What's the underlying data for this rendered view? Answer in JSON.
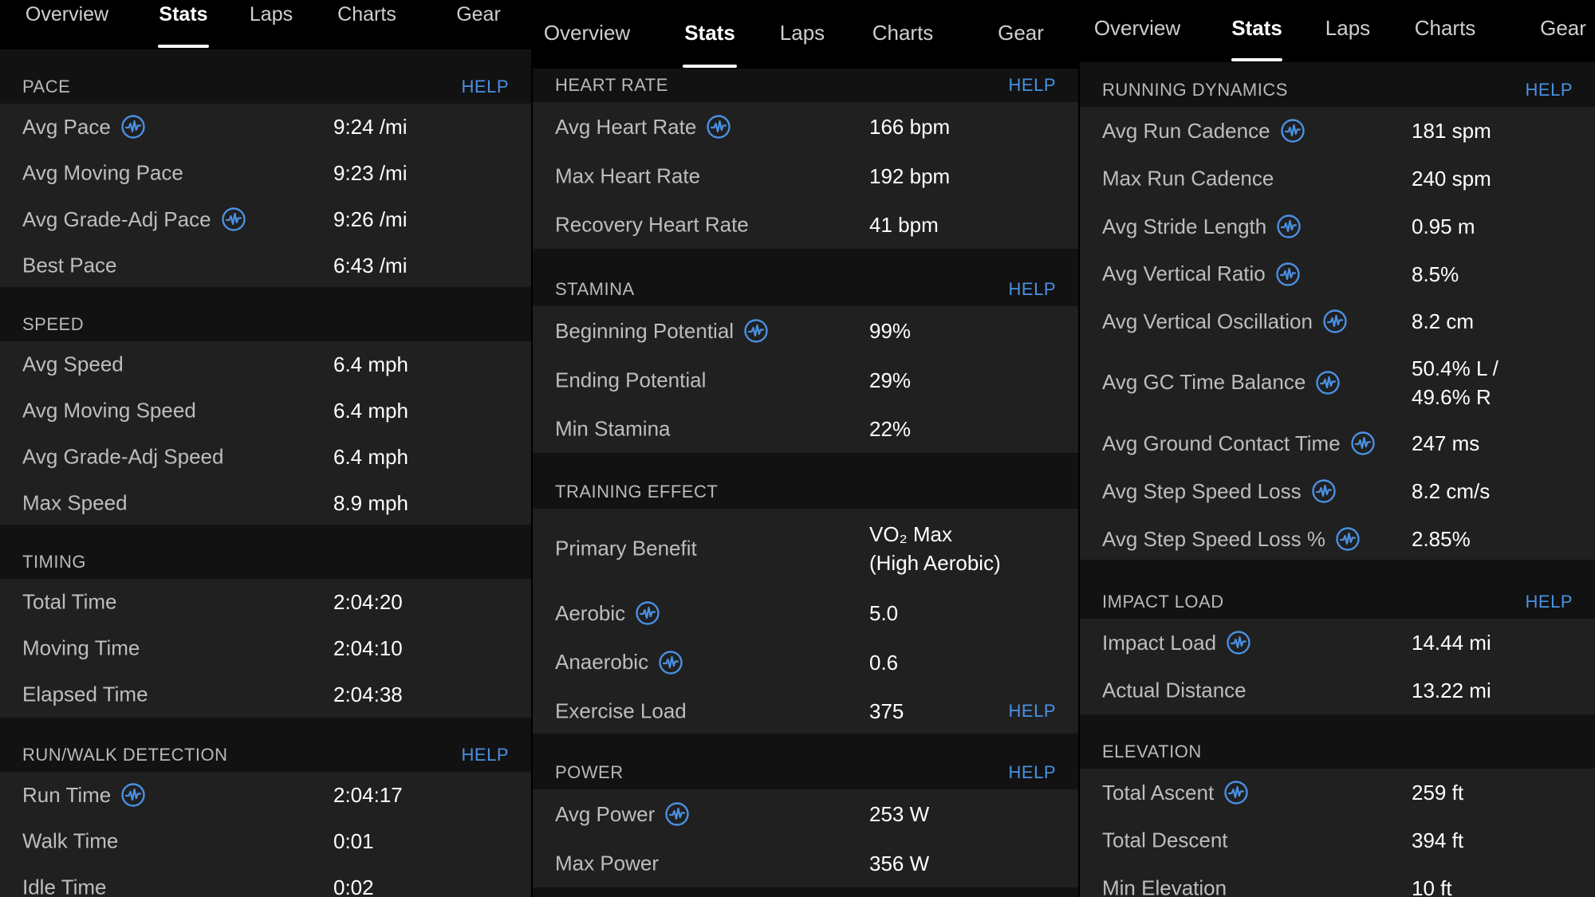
{
  "colors": {
    "accent": "#4a90e2",
    "background": "#121212",
    "row_background": "#202020",
    "header_background": "#000000"
  },
  "panels": [
    {
      "tabs": [
        {
          "label": "Overview",
          "name": "tab-overview",
          "active": false
        },
        {
          "label": "Stats",
          "name": "tab-stats",
          "active": true
        },
        {
          "label": "Laps",
          "name": "tab-laps",
          "active": false
        },
        {
          "label": "Charts",
          "name": "tab-charts",
          "active": false
        },
        {
          "label": "Gear",
          "name": "tab-gear",
          "active": false
        }
      ],
      "sections": [
        {
          "title": "PACE",
          "help": "HELP",
          "rows": [
            {
              "label": "Avg Pace",
              "chart_icon": "waveform-icon",
              "value": "9:24 /mi"
            },
            {
              "label": "Avg Moving Pace",
              "value": "9:23 /mi"
            },
            {
              "label": "Avg Grade-Adj Pace",
              "chart_icon": "waveform-icon",
              "value": "9:26 /mi"
            },
            {
              "label": "Best Pace",
              "value": "6:43 /mi"
            }
          ]
        },
        {
          "title": "SPEED",
          "rows": [
            {
              "label": "Avg Speed",
              "value": "6.4 mph"
            },
            {
              "label": "Avg Moving Speed",
              "value": "6.4 mph"
            },
            {
              "label": "Avg Grade-Adj Speed",
              "value": "6.4 mph"
            },
            {
              "label": "Max Speed",
              "value": "8.9 mph"
            }
          ]
        },
        {
          "title": "TIMING",
          "rows": [
            {
              "label": "Total Time",
              "value": "2:04:20"
            },
            {
              "label": "Moving Time",
              "value": "2:04:10"
            },
            {
              "label": "Elapsed Time",
              "value": "2:04:38"
            }
          ]
        },
        {
          "title": "RUN/WALK DETECTION",
          "help": "HELP",
          "rows": [
            {
              "label": "Run Time",
              "chart_icon": "waveform-icon",
              "value": "2:04:17"
            },
            {
              "label": "Walk Time",
              "value": "0:01"
            },
            {
              "label": "Idle Time",
              "value": "0:02"
            }
          ]
        }
      ]
    },
    {
      "tabs": [
        {
          "label": "Overview",
          "name": "tab-overview",
          "active": false
        },
        {
          "label": "Stats",
          "name": "tab-stats",
          "active": true
        },
        {
          "label": "Laps",
          "name": "tab-laps",
          "active": false
        },
        {
          "label": "Charts",
          "name": "tab-charts",
          "active": false
        },
        {
          "label": "Gear",
          "name": "tab-gear",
          "active": false
        }
      ],
      "sections": [
        {
          "title": "HEART RATE",
          "help": "HELP",
          "rows": [
            {
              "label": "Avg Heart Rate",
              "chart_icon": "waveform-icon",
              "value": "166 bpm"
            },
            {
              "label": "Max Heart Rate",
              "value": "192 bpm"
            },
            {
              "label": "Recovery Heart Rate",
              "value": "41 bpm"
            }
          ]
        },
        {
          "title": "STAMINA",
          "help": "HELP",
          "rows": [
            {
              "label": "Beginning Potential",
              "chart_icon": "waveform-icon",
              "value": "99%"
            },
            {
              "label": "Ending Potential",
              "value": "29%"
            },
            {
              "label": "Min Stamina",
              "value": "22%"
            }
          ]
        },
        {
          "title": "TRAINING EFFECT",
          "rows": [
            {
              "label": "Primary Benefit",
              "value": "VO₂ Max\n(High Aerobic)"
            },
            {
              "label": "Aerobic",
              "chart_icon": "waveform-icon",
              "value": "5.0"
            },
            {
              "label": "Anaerobic",
              "chart_icon": "waveform-icon",
              "value": "0.6"
            },
            {
              "label": "Exercise Load",
              "value": "375",
              "help": "HELP"
            }
          ]
        },
        {
          "title": "POWER",
          "help": "HELP",
          "rows": [
            {
              "label": "Avg Power",
              "chart_icon": "waveform-icon",
              "value": "253 W"
            },
            {
              "label": "Max Power",
              "value": "356 W"
            }
          ]
        }
      ]
    },
    {
      "tabs": [
        {
          "label": "Overview",
          "name": "tab-overview",
          "active": false
        },
        {
          "label": "Stats",
          "name": "tab-stats",
          "active": true
        },
        {
          "label": "Laps",
          "name": "tab-laps",
          "active": false
        },
        {
          "label": "Charts",
          "name": "tab-charts",
          "active": false
        },
        {
          "label": "Gear",
          "name": "tab-gear",
          "active": false
        }
      ],
      "sections": [
        {
          "title": "RUNNING DYNAMICS",
          "help": "HELP",
          "rows": [
            {
              "label": "Avg Run Cadence",
              "chart_icon": "waveform-icon",
              "value": "181 spm"
            },
            {
              "label": "Max Run Cadence",
              "value": "240 spm"
            },
            {
              "label": "Avg Stride Length",
              "chart_icon": "waveform-icon",
              "value": "0.95 m"
            },
            {
              "label": "Avg Vertical Ratio",
              "chart_icon": "waveform-icon",
              "value": "8.5%"
            },
            {
              "label": "Avg Vertical Oscillation",
              "chart_icon": "waveform-icon",
              "value": "8.2 cm"
            },
            {
              "label": "Avg GC Time Balance",
              "chart_icon": "waveform-icon",
              "value": "50.4% L /\n49.6% R"
            },
            {
              "label": "Avg Ground Contact Time",
              "chart_icon": "waveform-icon",
              "value": "247 ms"
            },
            {
              "label": "Avg Step Speed Loss",
              "chart_icon": "waveform-icon",
              "value": "8.2 cm/s"
            },
            {
              "label": "Avg Step Speed Loss %",
              "chart_icon": "waveform-icon",
              "value": "2.85%"
            }
          ]
        },
        {
          "title": "IMPACT LOAD",
          "help": "HELP",
          "rows": [
            {
              "label": "Impact Load",
              "chart_icon": "waveform-icon",
              "value": "14.44 mi"
            },
            {
              "label": "Actual Distance",
              "value": "13.22 mi"
            }
          ]
        },
        {
          "title": "ELEVATION",
          "rows": [
            {
              "label": "Total Ascent",
              "chart_icon": "waveform-icon",
              "value": "259 ft"
            },
            {
              "label": "Total Descent",
              "value": "394 ft"
            },
            {
              "label": "Min Elevation",
              "value": "10 ft"
            }
          ]
        }
      ]
    }
  ]
}
